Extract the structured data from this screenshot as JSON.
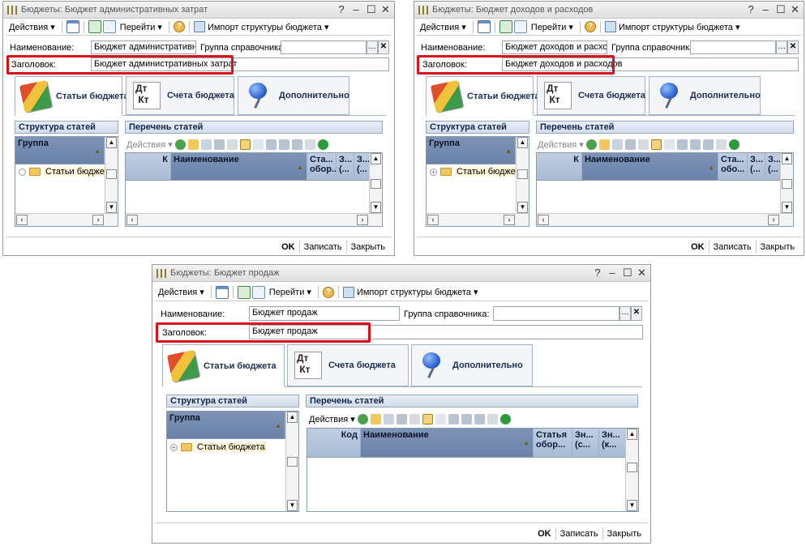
{
  "windows": [
    {
      "title": "Бюджеты: Бюджет административных затрат",
      "toolbar": {
        "actions": "Действия",
        "goto": "Перейти",
        "import": "Импорт структуры бюджета"
      },
      "fields": {
        "name_label": "Наименование:",
        "name_value": "Бюджет административных з",
        "group_label": "Группа справочника:",
        "group_value": "",
        "header_label": "Заголовок:",
        "header_value": "Бюджет административных затрат"
      },
      "tabs": [
        "Статьи бюджета",
        "Счета бюджета",
        "Дополнительно"
      ],
      "left_panel": {
        "title": "Структура статей",
        "column": "Группа",
        "tree_item": "Статьи бюджета"
      },
      "right_panel": {
        "title": "Перечень статей",
        "actions": "Действия",
        "columns": [
          "К",
          "Наименование",
          "Ста... обор...",
          "З... (...",
          "З... (..."
        ]
      },
      "footer": {
        "ok": "OK",
        "save": "Записать",
        "close": "Закрыть"
      }
    },
    {
      "title": "Бюджеты: Бюджет доходов и расходов",
      "toolbar": {
        "actions": "Действия",
        "goto": "Перейти",
        "import": "Импорт структуры бюджета"
      },
      "fields": {
        "name_label": "Наименование:",
        "name_value": "Бюджет доходов и расходов",
        "group_label": "Группа справочника:",
        "group_value": "",
        "header_label": "Заголовок:",
        "header_value": "Бюджет доходов и расходов"
      },
      "tabs": [
        "Статьи бюджета",
        "Счета бюджета",
        "Дополнительно"
      ],
      "left_panel": {
        "title": "Структура статей",
        "column": "Группа",
        "tree_item": "Статьи бюджета"
      },
      "right_panel": {
        "title": "Перечень статей",
        "actions": "Действия",
        "columns": [
          "К",
          "Наименование",
          "Ста... обо...",
          "З... (...",
          "З... (..."
        ]
      },
      "footer": {
        "ok": "OK",
        "save": "Записать",
        "close": "Закрыть"
      }
    },
    {
      "title": "Бюджеты: Бюджет продаж",
      "toolbar": {
        "actions": "Действия",
        "goto": "Перейти",
        "import": "Импорт структуры бюджета"
      },
      "fields": {
        "name_label": "Наименование:",
        "name_value": "Бюджет продаж",
        "group_label": "Группа справочника:",
        "group_value": "",
        "header_label": "Заголовок:",
        "header_value": "Бюджет продаж"
      },
      "tabs": [
        "Статьи бюджета",
        "Счета бюджета",
        "Дополнительно"
      ],
      "left_panel": {
        "title": "Структура статей",
        "column": "Группа",
        "tree_item": "Статьи бюджета"
      },
      "right_panel": {
        "title": "Перечень статей",
        "actions": "Действия",
        "columns": [
          "Код",
          "Наименование",
          "Статья обор...",
          "Зн... (с...",
          "Зн... (к..."
        ]
      },
      "footer": {
        "ok": "OK",
        "save": "Записать",
        "close": "Закрыть"
      }
    }
  ],
  "accent_highlight": "#d8121b",
  "icons": {
    "tab_0": "budget-articles-icon",
    "tab_1": "debit-credit-icon",
    "tab_2": "pushpin-icon"
  }
}
